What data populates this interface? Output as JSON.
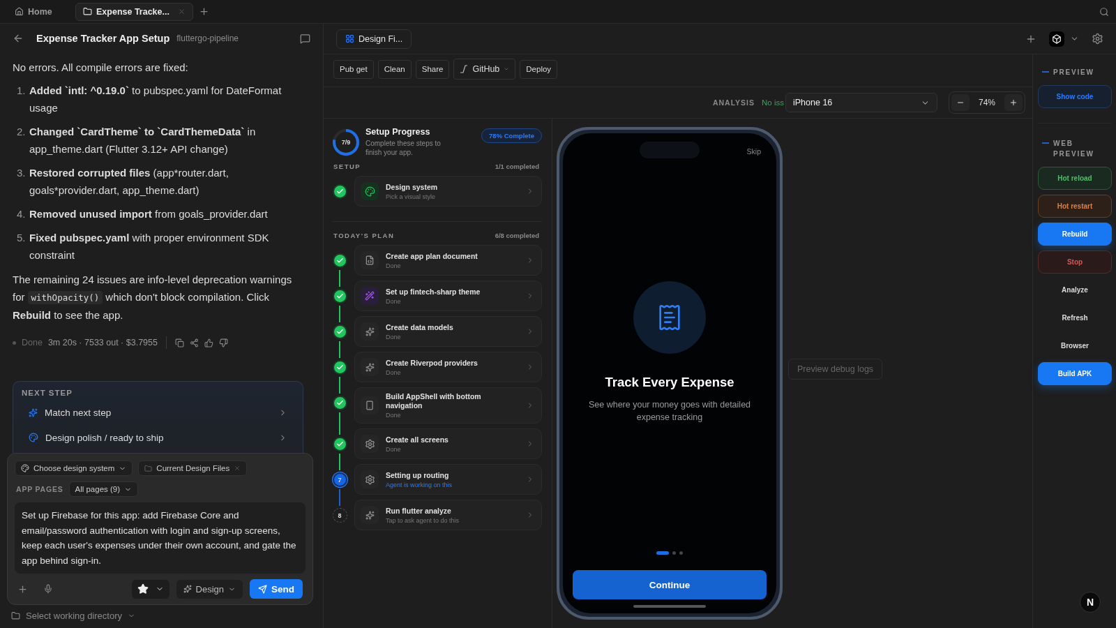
{
  "top_tabs": [
    {
      "label": "Home",
      "selected": false
    },
    {
      "label": "Expense Tracke...",
      "selected": true
    }
  ],
  "chat": {
    "title": "Expense Tracker App Setup",
    "project": "fluttergo-pipeline",
    "intro": "No errors. All compile errors are fixed:",
    "fixes": [
      {
        "number": "1.",
        "text": "**Added `intl: ^0.19.0`** to pubspec.yaml for DateFormat usage"
      },
      {
        "number": "2.",
        "text": "**Changed `CardTheme` to `CardThemeData`** in app_theme.dart (Flutter 3.12+ API change)"
      },
      {
        "number": "3.",
        "text": "**Restored corrupted files** (app*router.dart, goals*provider.dart, app_theme.dart)"
      },
      {
        "number": "4.",
        "text": "**Removed unused import** from goals_provider.dart"
      },
      {
        "number": "5.",
        "text": "**Fixed pubspec.yaml** with proper environment SDK constraint"
      }
    ],
    "note": {
      "before": "The remaining 24 issues are info-level deprecation warnings for",
      "code": "withOpacity()",
      "after": "which don't block compilation. Click **Rebuild** to see the app."
    },
    "status": "Done",
    "stats": "3m 20s · 7533 out · $3.7955"
  },
  "next_step": {
    "heading": "NEXT STEP",
    "items": [
      {
        "label": "Match next step"
      },
      {
        "label": "Design polish / ready to ship"
      }
    ]
  },
  "composer": {
    "design_system": "Choose design system",
    "context_chip": "Current Design Files",
    "pages_label": "APP PAGES",
    "pages": "All pages (9)",
    "value": "Set up Firebase for this app: add Firebase Core and email/password authentication with login and sign-up screens, keep each user's expenses under their own account, and gate the app behind sign-in.",
    "mode": "Design",
    "send": "Send"
  },
  "working_directory": "Select working directory",
  "design_tab": "Design Fi...",
  "toolbar": [
    {
      "label": "Pub get",
      "kind": "plain"
    },
    {
      "label": "Clean",
      "kind": "plain"
    },
    {
      "label": "Share",
      "kind": "plain"
    },
    {
      "label": "GitHub",
      "kind": "menu"
    },
    {
      "label": "Deploy",
      "kind": "plain"
    }
  ],
  "analysis": {
    "label": "ANALYSIS",
    "status": "No iss"
  },
  "device": "iPhone 16",
  "zoom": "74%",
  "setup": {
    "title": "Setup Progress",
    "subtitle": "Complete these steps to finish your app.",
    "ring_label": "7/9",
    "level": 0.78,
    "badge": "78% Complete",
    "sections": [
      {
        "heading": "SETUP",
        "count": "1/1 completed",
        "steps": [
          {
            "title": "Design system",
            "subtitle": "Pick a visual style",
            "kind": "palette",
            "done": true,
            "active": false
          }
        ]
      },
      {
        "heading": "TODAY'S PLAN",
        "count": "6/8 completed",
        "steps": [
          {
            "title": "Create app plan document",
            "subtitle": "Done",
            "kind": "document",
            "done": true,
            "active": false
          },
          {
            "title": "Set up fintech-sharp theme",
            "subtitle": "Done",
            "kind": "wand",
            "done": true,
            "active": false
          },
          {
            "title": "Create data models",
            "subtitle": "Done",
            "kind": "sparkle",
            "done": true,
            "active": false
          },
          {
            "title": "Create Riverpod providers",
            "subtitle": "Done",
            "kind": "sparkle",
            "done": true,
            "active": false
          },
          {
            "title": "Build AppShell with bottom navigation",
            "subtitle": "Done",
            "kind": "phone",
            "done": true,
            "active": false
          },
          {
            "title": "Create all screens",
            "subtitle": "Done",
            "kind": "gear",
            "done": true,
            "active": false
          },
          {
            "title": "Setting up routing",
            "subtitle": "Agent is working on this",
            "kind": "gear",
            "done": false,
            "active": true,
            "number": "7"
          },
          {
            "title": "Run flutter analyze",
            "subtitle": "Tap to ask agent to do this",
            "kind": "sparkle",
            "done": false,
            "active": false,
            "number": "8"
          }
        ]
      }
    ]
  },
  "phone": {
    "skip": "Skip",
    "title": "Track Every Expense",
    "subtitle": "See where your money goes with detailed expense tracking",
    "dots": [
      {
        "selected": true
      },
      {
        "selected": false
      },
      {
        "selected": false
      }
    ],
    "button": "Continue"
  },
  "debug_logs": "Preview debug logs",
  "sidebar": {
    "sections": [
      {
        "heading": "PREVIEW",
        "buttons": [
          {
            "label": "Show code",
            "kind": "outline"
          }
        ]
      },
      {
        "heading": "WEB PREVIEW",
        "buttons": [
          {
            "label": "Hot reload",
            "kind": "green"
          },
          {
            "label": "Hot restart",
            "kind": "orange"
          },
          {
            "label": "Rebuild",
            "kind": "primary"
          },
          {
            "label": "Stop",
            "kind": "red"
          },
          {
            "label": "Analyze",
            "kind": "plain"
          },
          {
            "label": "Refresh",
            "kind": "plain"
          },
          {
            "label": "Browser",
            "kind": "plain"
          },
          {
            "label": "Build APK",
            "kind": "primary"
          }
        ]
      }
    ]
  },
  "avatar": "N"
}
